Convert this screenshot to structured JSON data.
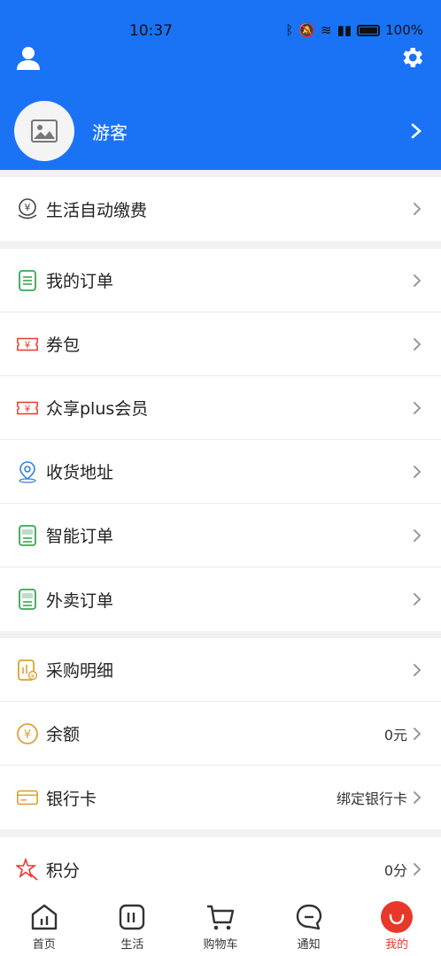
{
  "status_bar": {
    "time": "10:37",
    "battery": "100%"
  },
  "header": {
    "username": "游客"
  },
  "sections": [
    {
      "items": [
        {
          "label": "生活自动缴费",
          "value": ""
        }
      ]
    },
    {
      "items": [
        {
          "label": "我的订单",
          "value": ""
        },
        {
          "label": "券包",
          "value": ""
        },
        {
          "label": "众享plus会员",
          "value": ""
        },
        {
          "label": "收货地址",
          "value": ""
        },
        {
          "label": "智能订单",
          "value": ""
        },
        {
          "label": "外卖订单",
          "value": ""
        }
      ]
    },
    {
      "items": [
        {
          "label": "采购明细",
          "value": ""
        },
        {
          "label": "余额",
          "value": "0元"
        },
        {
          "label": "银行卡",
          "value": "绑定银行卡"
        }
      ]
    },
    {
      "items": [
        {
          "label": "积分",
          "value": "0分"
        }
      ]
    }
  ],
  "icons": {
    "auto_pay": "auto-pay-icon",
    "orders": "order-list-icon",
    "coupon": "coupon-icon",
    "address": "location-pin-icon",
    "balance": "yuan-coin-icon",
    "bank": "bank-card-icon",
    "points": "star-icon"
  },
  "bottom_nav": [
    {
      "label": "首页",
      "active": false
    },
    {
      "label": "生活",
      "active": false
    },
    {
      "label": "购物车",
      "active": false
    },
    {
      "label": "通知",
      "active": false
    },
    {
      "label": "我的",
      "active": true
    }
  ],
  "colors": {
    "header_blue": "#1a73f5",
    "active_red": "#e8382b"
  }
}
